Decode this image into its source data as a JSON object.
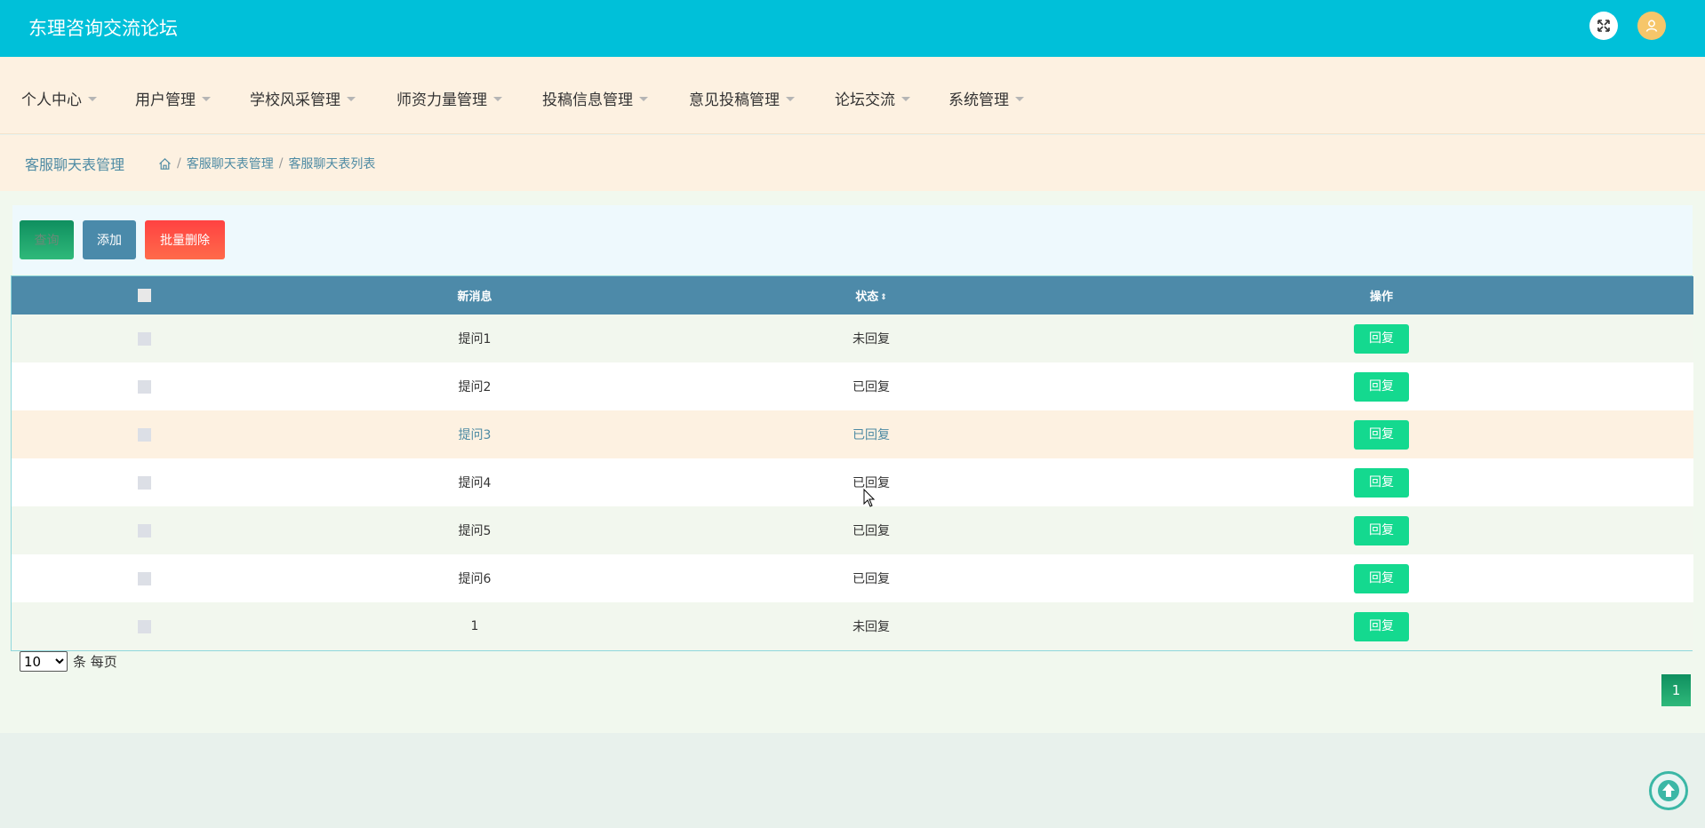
{
  "header": {
    "title": "东理咨询交流论坛"
  },
  "nav": {
    "items": [
      "个人中心",
      "用户管理",
      "学校风采管理",
      "师资力量管理",
      "投稿信息管理",
      "意见投稿管理",
      "论坛交流",
      "系统管理"
    ]
  },
  "breadcrumb": {
    "title": "客服聊天表管理",
    "path": [
      "客服聊天表管理",
      "客服聊天表列表"
    ]
  },
  "toolbar": {
    "search_label": "查询",
    "add_label": "添加",
    "batch_delete_label": "批量删除"
  },
  "table": {
    "headers": [
      "新消息",
      "状态",
      "操作"
    ],
    "rows": [
      {
        "message": "提问1",
        "status": "未回复",
        "action": "回复"
      },
      {
        "message": "提问2",
        "status": "已回复",
        "action": "回复"
      },
      {
        "message": "提问3",
        "status": "已回复",
        "action": "回复"
      },
      {
        "message": "提问4",
        "status": "已回复",
        "action": "回复"
      },
      {
        "message": "提问5",
        "status": "已回复",
        "action": "回复"
      },
      {
        "message": "提问6",
        "status": "已回复",
        "action": "回复"
      },
      {
        "message": "1",
        "status": "未回复",
        "action": "回复"
      }
    ]
  },
  "pagination": {
    "page_size": "10",
    "page_size_suffix": "条 每页",
    "current_page": "1"
  },
  "colors": {
    "header_bg": "#00c0d9",
    "nav_bg": "#fdf1e1",
    "table_header_bg": "#4d8aa9",
    "reply_button": "#14d98f",
    "batch_delete_button": "#ff4242"
  }
}
